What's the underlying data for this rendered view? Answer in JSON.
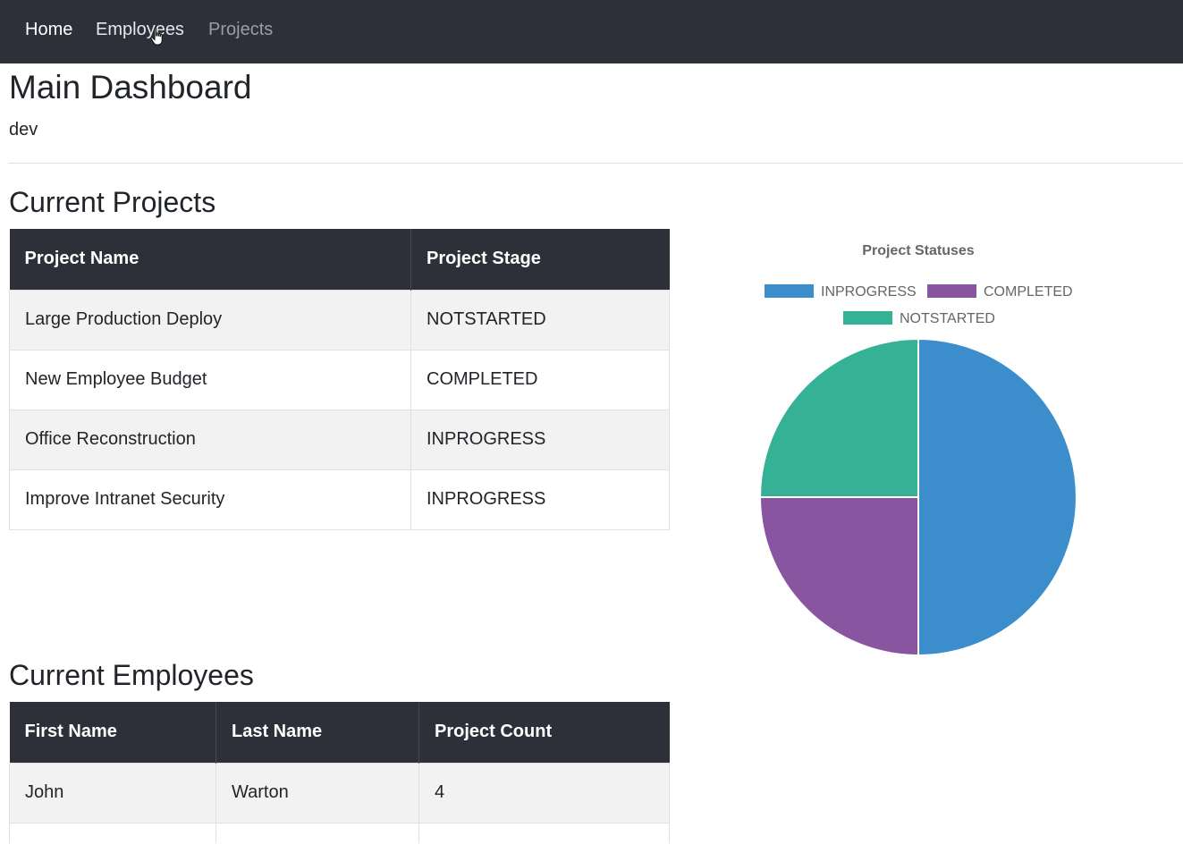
{
  "nav": {
    "items": [
      {
        "label": "Home"
      },
      {
        "label": "Employees"
      },
      {
        "label": "Projects"
      }
    ]
  },
  "header": {
    "title": "Main Dashboard",
    "user": "dev"
  },
  "projects": {
    "title": "Current Projects",
    "columns": [
      "Project Name",
      "Project Stage"
    ],
    "rows": [
      [
        "Large Production Deploy",
        "NOTSTARTED"
      ],
      [
        "New Employee Budget",
        "COMPLETED"
      ],
      [
        "Office Reconstruction",
        "INPROGRESS"
      ],
      [
        "Improve Intranet Security",
        "INPROGRESS"
      ]
    ]
  },
  "employees": {
    "title": "Current Employees",
    "columns": [
      "First Name",
      "Last Name",
      "Project Count"
    ],
    "rows": [
      [
        "John",
        "Warton",
        "4"
      ],
      [
        "",
        "",
        ""
      ]
    ]
  },
  "chart_data": {
    "type": "pie",
    "title": "Project Statuses",
    "categories": [
      "INPROGRESS",
      "COMPLETED",
      "NOTSTARTED"
    ],
    "values": [
      2,
      1,
      1
    ],
    "colors": [
      "#3c8dcb",
      "#8a55a0",
      "#35b295"
    ],
    "legend": "top"
  },
  "colors": {
    "navbar": "#2d3039",
    "table_header": "#2d3039",
    "striped_row": "#f2f2f2"
  }
}
